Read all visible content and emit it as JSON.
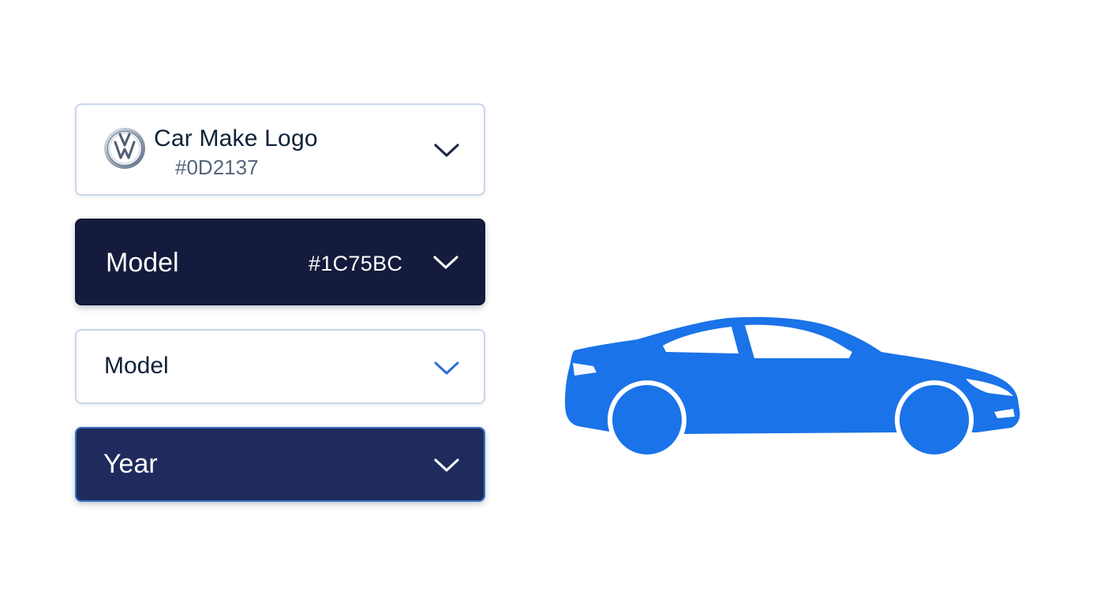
{
  "make_selector": {
    "title": "Car Make Logo",
    "hex": "#0D2137",
    "logo_icon": "vw-logo-icon",
    "chevron_icon": "chevron-down-icon"
  },
  "model_dark_selector": {
    "label": "Model",
    "hex": "#1C75BC",
    "chevron_icon": "chevron-down-icon"
  },
  "model_light_selector": {
    "label": "Model",
    "chevron_icon": "chevron-down-icon"
  },
  "year_selector": {
    "label": "Year",
    "chevron_icon": "chevron-down-icon"
  },
  "car_illustration": {
    "icon": "car-side-silhouette-icon"
  },
  "colors": {
    "navy": "#0D2137",
    "dark_panel": "#141B3C",
    "year_panel": "#1F2B5D",
    "accent_blue": "#1C75BC",
    "car_blue": "#1A73E8",
    "border_light": "#C9D7EA"
  }
}
